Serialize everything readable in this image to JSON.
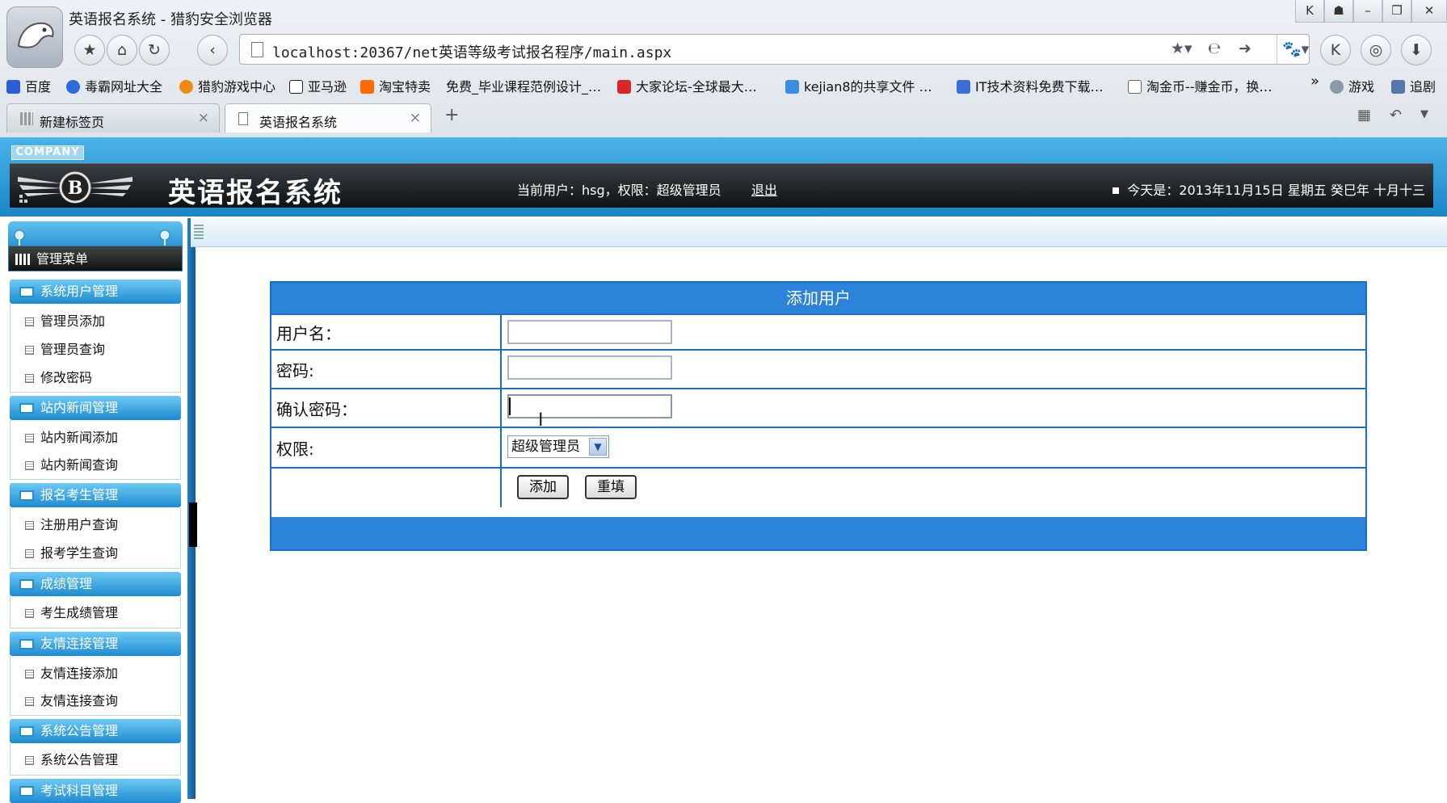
{
  "browser": {
    "window_title": "英语报名系统 - 猎豹安全浏览器",
    "url": "localhost:20367/net英语等级考试报名程序/main.aspx",
    "bookmarks": [
      {
        "label": "百度",
        "color": "#2b5fd9"
      },
      {
        "label": "毒霸网址大全",
        "color": "#2a6cd8"
      },
      {
        "label": "猎豹游戏中心",
        "color": "#f08a12"
      },
      {
        "label": "亚马逊",
        "color": "#222222"
      },
      {
        "label": "淘宝特卖",
        "color": "#ff6a00"
      },
      {
        "label": "免费_毕业课程范例设计_…",
        "color": ""
      },
      {
        "label": "大家论坛-全球最大…",
        "color": "#d8262b"
      },
      {
        "label": "kejian8的共享文件 …",
        "color": "#3a8de0"
      },
      {
        "label": "IT技术资料免费下载…",
        "color": "#3a6ed8"
      },
      {
        "label": "淘金币--赚金币，换…",
        "color": "#ffffff"
      },
      {
        "label": "游戏",
        "color": "#8899aa"
      },
      {
        "label": "追剧",
        "color": "#5577aa"
      }
    ],
    "overflow_label": "»",
    "tabs": [
      {
        "label": "新建标签页",
        "close": "×"
      },
      {
        "label": "英语报名系统",
        "close": "×"
      }
    ],
    "new_tab": "+"
  },
  "header": {
    "company": "COMPANY",
    "title": "英语报名系统",
    "current_user": "当前用户：hsg，权限：超级管理员",
    "logout": "退出",
    "date": "今天是：2013年11月15日 星期五 癸巳年 十月十三"
  },
  "sidebar": {
    "menu_title": "管理菜单",
    "sections": [
      {
        "title": "系统用户管理",
        "items": [
          "管理员添加",
          "管理员查询",
          "修改密码"
        ]
      },
      {
        "title": "站内新闻管理",
        "items": [
          "站内新闻添加",
          "站内新闻查询"
        ]
      },
      {
        "title": "报名考生管理",
        "items": [
          "注册用户查询",
          "报考学生查询"
        ]
      },
      {
        "title": "成绩管理",
        "items": [
          "考生成绩管理"
        ]
      },
      {
        "title": "友情连接管理",
        "items": [
          "友情连接添加",
          "友情连接查询"
        ]
      },
      {
        "title": "系统公告管理",
        "items": [
          "系统公告管理"
        ]
      },
      {
        "title": "考试科目管理",
        "items": []
      }
    ]
  },
  "form": {
    "title": "添加用户",
    "username_label": "用户名：",
    "username_value": "",
    "password_label": "密码:",
    "password_value": "",
    "confirm_label": "确认密码：",
    "confirm_value": "",
    "role_label": "权限:",
    "role_selected": "超级管理员",
    "submit": "添加",
    "reset": "重填"
  },
  "colors": {
    "header_blue": "#1a86c7",
    "form_blue": "#2d82d9",
    "sidebar_header": "#1e8ad0"
  }
}
